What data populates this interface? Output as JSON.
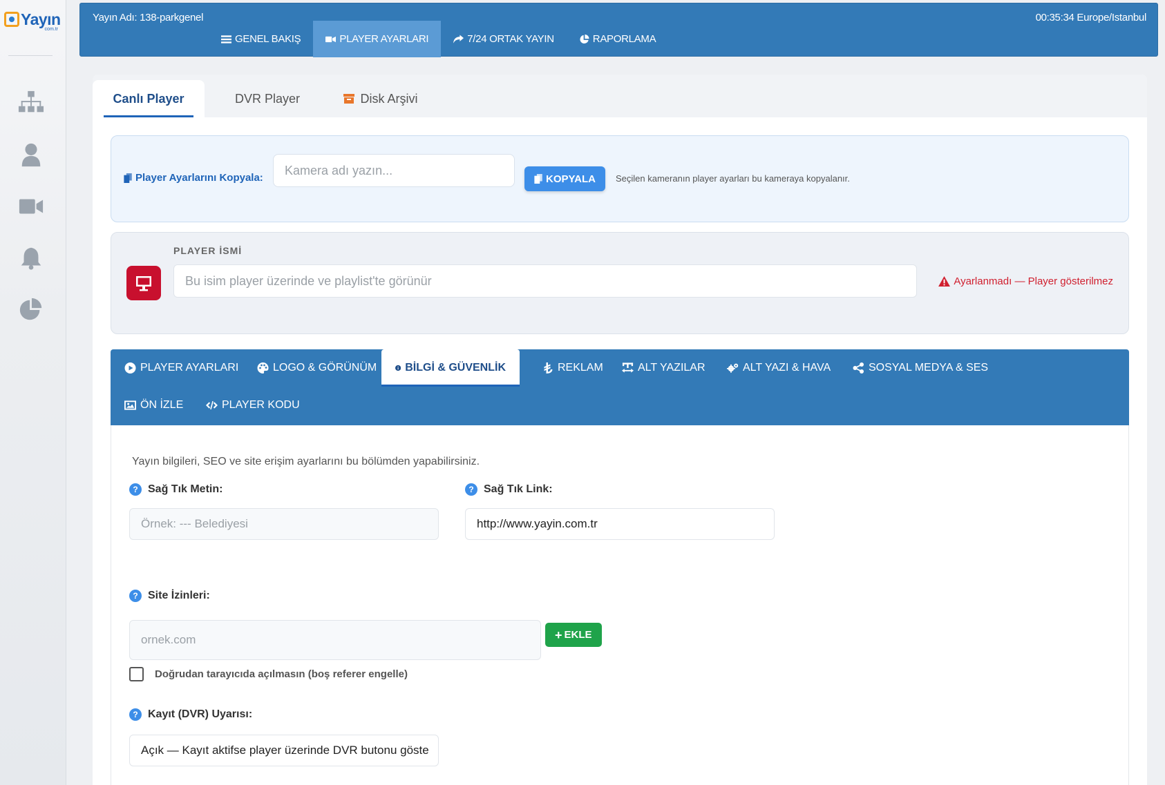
{
  "brand": {
    "logo_text": "Yayın",
    "logo_sub": "com.tr"
  },
  "sidebar": {
    "icons": [
      "sitemap-icon",
      "user-icon",
      "video-icon",
      "bell-icon",
      "pie-chart-icon"
    ]
  },
  "header": {
    "title": "Yayın Adı: 138-parkgenel",
    "time": "00:35:34 Europe/Istanbul",
    "nav": [
      {
        "label": "GENEL BAKIŞ",
        "icon": "bars-icon"
      },
      {
        "label": "PLAYER AYARLARI",
        "icon": "video-icon",
        "active": true
      },
      {
        "label": "7/24 ORTAK YAYIN",
        "icon": "share-icon"
      },
      {
        "label": "RAPORLAMA",
        "icon": "pie-chart-icon"
      }
    ]
  },
  "tabs": [
    {
      "label": "Canlı Player",
      "active": true
    },
    {
      "label": "DVR Player"
    },
    {
      "label": "Disk Arşivi",
      "icon": "archive-icon"
    }
  ],
  "copy": {
    "label": "Player Ayarlarını Kopyala:",
    "placeholder": "Kamera adı yazın...",
    "button": "KOPYALA",
    "hint": "Seçilen kameranın player ayarları bu kameraya kopyalanır."
  },
  "player_name": {
    "label": "PLAYER İSMİ",
    "placeholder": "Bu isim player üzerinde ve playlist'te görünür",
    "warning": "Ayarlanmadı — Player gösterilmez"
  },
  "subtabs": [
    {
      "label": "PLAYER AYARLARI",
      "icon": "play-circle-icon"
    },
    {
      "label": "LOGO & GÖRÜNÜM",
      "icon": "palette-icon"
    },
    {
      "label": "BİLGİ & GÜVENLİK",
      "icon": "info-circle-icon",
      "active": true
    },
    {
      "label": "REKLAM",
      "icon": "lira-icon"
    },
    {
      "label": "ALT YAZILAR",
      "icon": "text-width-icon"
    },
    {
      "label": "ALT YAZI & HAVA",
      "icon": "cogs-icon"
    },
    {
      "label": "SOSYAL MEDYA & SES",
      "icon": "share-nodes-icon"
    },
    {
      "label": "ÖN İZLE",
      "icon": "image-icon"
    },
    {
      "label": "PLAYER KODU",
      "icon": "code-icon"
    }
  ],
  "content": {
    "intro": "Yayın bilgileri, SEO ve site erişim ayarlarını bu bölümden yapabilirsiniz.",
    "right_click_text": {
      "label": "Sağ Tık Metin:",
      "placeholder": "Örnek: --- Belediyesi",
      "value": ""
    },
    "right_click_link": {
      "label": "Sağ Tık Link:",
      "value": "http://www.yayin.com.tr"
    },
    "site_permissions": {
      "label": "Site İzinleri:",
      "placeholder": "ornek.com",
      "button": "EKLE"
    },
    "no_direct": {
      "label": "Doğrudan tarayıcıda açılmasın (boş referer engelle)",
      "checked": false
    },
    "dvr_warning": {
      "label": "Kayıt (DVR) Uyarısı:",
      "value": "Açık — Kayıt aktifse player üzerinde DVR butonu göste"
    }
  },
  "colors": {
    "primary": "#337ab7",
    "accent": "#3d8ee8",
    "danger": "#d0202f",
    "success": "#1fa34a",
    "player_icon_bg": "#c8102e"
  }
}
